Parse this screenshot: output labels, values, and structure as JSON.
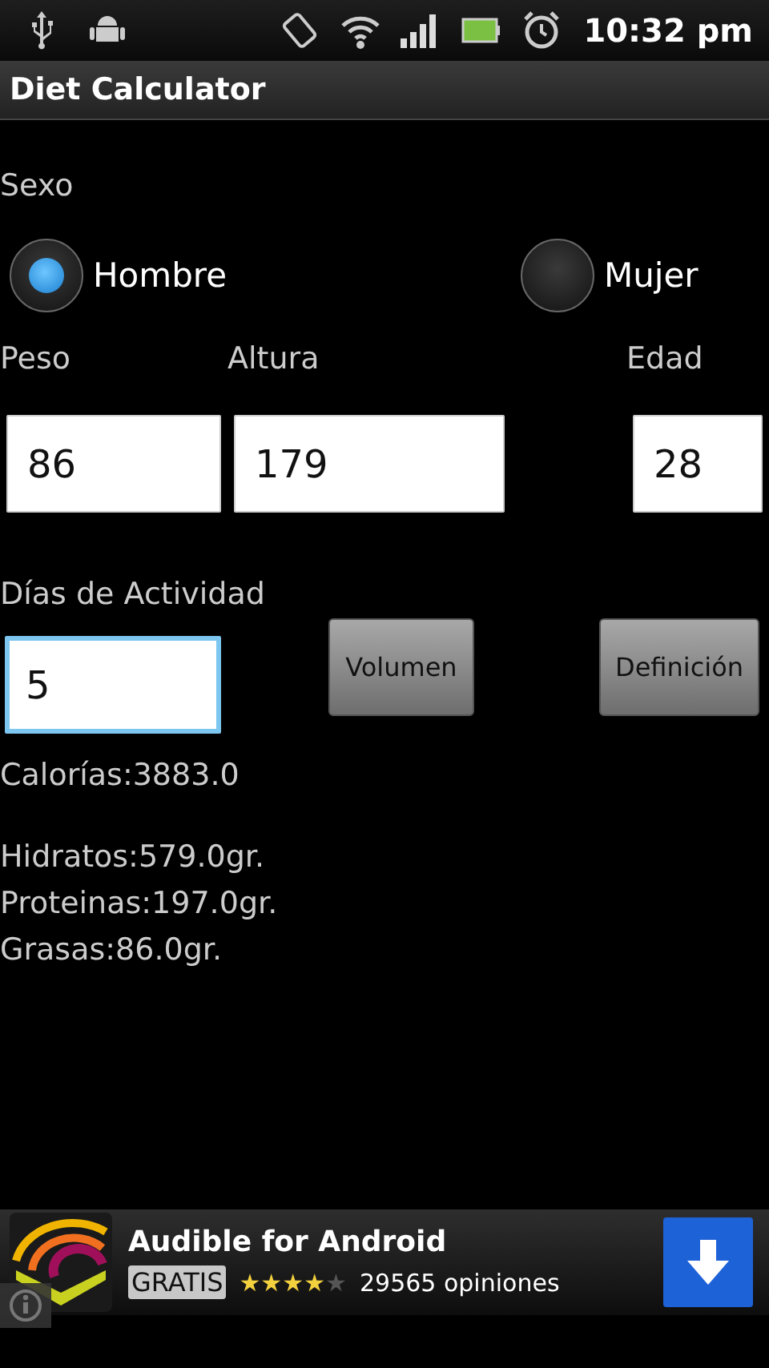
{
  "status_bar": {
    "time": "10:32 pm"
  },
  "title_bar": {
    "title": "Diet Calculator"
  },
  "sex": {
    "label": "Sexo",
    "options": [
      {
        "label": "Hombre",
        "selected": true
      },
      {
        "label": "Mujer",
        "selected": false
      }
    ]
  },
  "measures": [
    {
      "label": "Peso",
      "value": "86"
    },
    {
      "label": "Altura",
      "value": "179"
    },
    {
      "label": "Edad",
      "value": "28"
    }
  ],
  "activity": {
    "label": "Días de Actividad",
    "value": "5",
    "focused": true
  },
  "buttons": [
    "Volumen",
    "Definición"
  ],
  "results": {
    "calories": "Calorías:3883.0",
    "macros": [
      "Hidratos:579.0gr.",
      "Proteinas:197.0gr.",
      "Grasas:86.0gr."
    ]
  },
  "ad": {
    "title": "Audible for Android",
    "price": "GRATIS",
    "stars": 4,
    "reviews": "29565",
    "reviews_label": "opiniones"
  }
}
